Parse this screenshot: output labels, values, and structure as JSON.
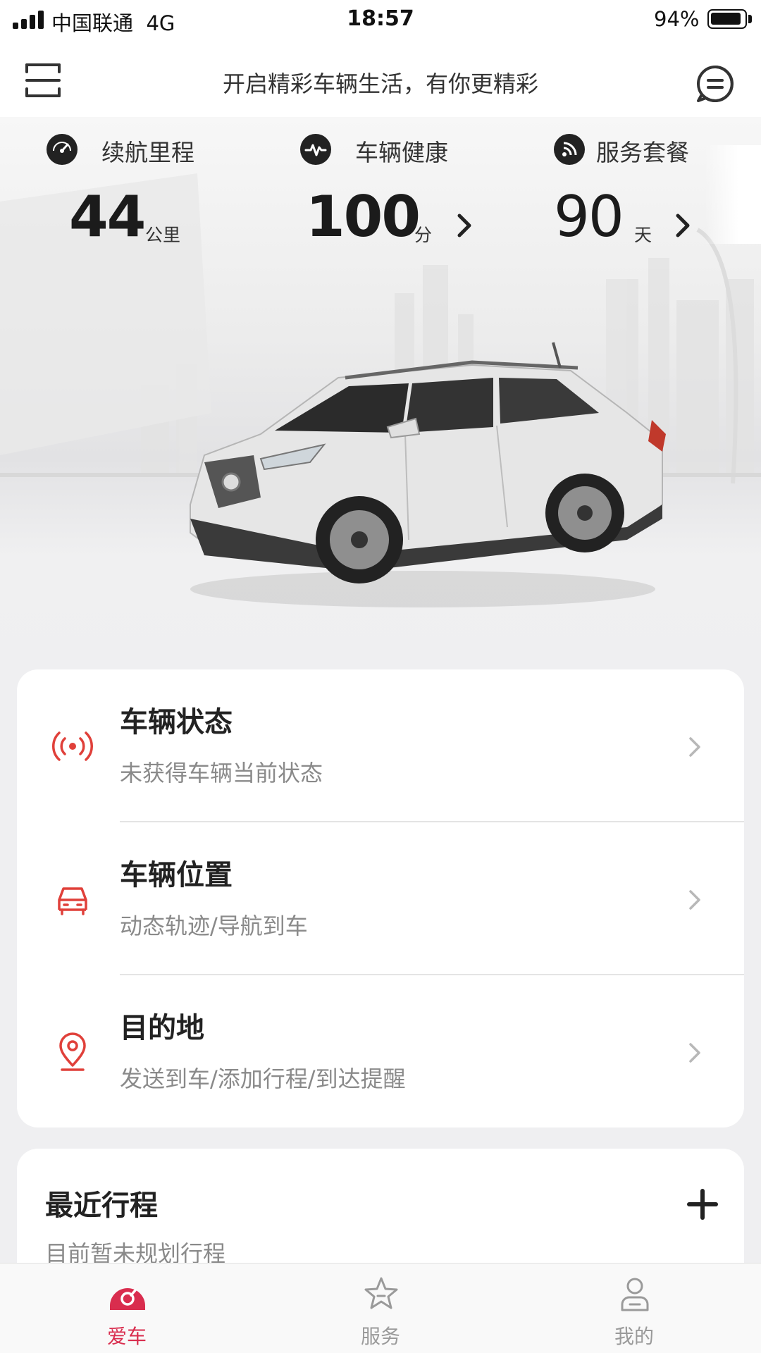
{
  "status_bar": {
    "carrier": "中国联通",
    "network": "4G",
    "time": "18:57",
    "battery_percent": "94%",
    "battery_level": 0.94
  },
  "header": {
    "title": "开启精彩车辆生活，有你更精彩",
    "menu_icon": "menu-icon",
    "message_icon": "message-icon"
  },
  "stats": [
    {
      "icon": "speedometer-icon",
      "label": "续航里程",
      "value": "44",
      "unit": "公里"
    },
    {
      "icon": "heartbeat-icon",
      "label": "车辆健康",
      "value": "100",
      "unit": "分"
    },
    {
      "icon": "service-package-icon",
      "label": "服务套餐",
      "value": "90",
      "unit": "天"
    }
  ],
  "vehicle_actions": [
    {
      "icon": "signal-icon",
      "title": "车辆状态",
      "subtitle": "未获得车辆当前状态"
    },
    {
      "icon": "car-icon",
      "title": "车辆位置",
      "subtitle": "动态轨迹/导航到车"
    },
    {
      "icon": "location-pin-icon",
      "title": "目的地",
      "subtitle": "发送到车/添加行程/到达提醒"
    }
  ],
  "trips": {
    "title": "最近行程",
    "empty_text": "目前暂未规划行程",
    "add_icon": "plus-icon"
  },
  "tabs": [
    {
      "icon": "car-tab-icon",
      "label": "爱车",
      "active": true
    },
    {
      "icon": "star-icon",
      "label": "服务",
      "active": false
    },
    {
      "icon": "user-icon",
      "label": "我的",
      "active": false
    }
  ],
  "colors": {
    "accent": "#d92d4e",
    "action_icon": "#e0403a",
    "secondary_text": "#8a8a8a"
  }
}
